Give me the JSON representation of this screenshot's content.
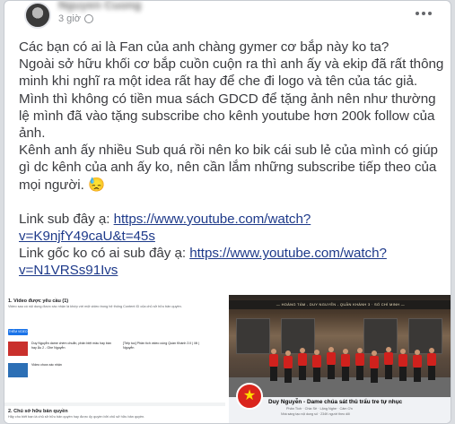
{
  "post": {
    "author": "Nguyen Cuong",
    "time": "3 giờ",
    "paragraphs": [
      "Các bạn có ai là Fan của anh chàng gymer cơ bắp này ko ta?",
      "Ngoài sở hữu khối cơ bắp cuồn cuộn ra thì anh ấy và ekip đã rất thông minh khi nghĩ ra một idea rất hay để che đi logo và tên của tác giả.",
      "Mình thì không có tiền mua sách GDCD để tặng ảnh nên như thường lệ mình đã vào tặng subscribe cho kênh youtube hơn 200k follow của ảnh.",
      "Kênh anh ấy nhiều Sub quá rồi nên ko bik cái sub lẻ của mình có giúp gì dc kênh của anh ấy ko, nên cần lắm những subscribe tiếp theo của mọi người. 😓"
    ],
    "link1_label": "Link sub đây ạ: ",
    "link1_url": "https://www.youtube.com/watch?v=K9njfY49caU&t=45s",
    "link2_label": "Link gốc ko có ai sub đây ạ: ",
    "link2_url": "https://www.youtube.com/watch?v=N1VRSs91Ivs"
  },
  "photo_left": {
    "section1_title": "1. Video được yêu cầu (1)",
    "section1_text": "Video sau có nội dung được xác nhận là khớp với một video trong hệ thống Content ID của chủ sở hữu bản quyền.",
    "button": "THÊM VIDEO",
    "row1_title": "Duy Nguyễn dame chém chuẩn, phân biệt mâu hay bần hay Ậu 2 - Ghe Nguyễn",
    "row1_meta": "[Tiếp tuc] Phân tích video cùng Quần Khánh 3 II | Mì | Nguyễn",
    "row2_title": "Video chưa xác nhận",
    "section2_title": "2. Chủ sở hữu bản quyền",
    "section2_text": "Hãy cho biết bạn là chủ sở hữu bản quyền hay được ủy quyền bởi chủ sở hữu bản quyền."
  },
  "photo_right": {
    "sign_text": "— HOÀNG TÁM - DUY NGUYỄN - QUẦN KHÁNH 3 · SỐ CHÍ MINH —",
    "flag_symbol": "★",
    "profile_name": "Duy Nguyễn - Dame chúa sát thủ trẩu tre tự nhục",
    "profile_sub": "Phân Tích · Chia Sẻ · Lặng Nghe · Cảm Ơn",
    "profile_sub2": "Nhà sáng tạo nội dung số · 234K người theo dõi"
  }
}
